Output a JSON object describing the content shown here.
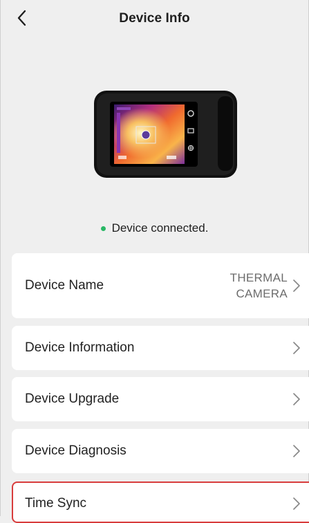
{
  "header": {
    "title": "Device Info",
    "back_icon": "chevron-left-icon"
  },
  "device": {
    "image_icon": "thermal-camera-image"
  },
  "status": {
    "text": "Device connected.",
    "dot_color": "#29b765"
  },
  "menu": {
    "device_name": {
      "label": "Device Name",
      "value_line1": "THERMAL",
      "value_line2": "CAMERA"
    },
    "device_information": {
      "label": "Device Information"
    },
    "device_upgrade": {
      "label": "Device Upgrade"
    },
    "device_diagnosis": {
      "label": "Device Diagnosis"
    },
    "time_sync": {
      "label": "Time Sync",
      "highlight_color": "#d83c3c"
    }
  },
  "colors": {
    "background": "#efefef",
    "card": "#ffffff",
    "value_text": "#6c6c6c"
  }
}
